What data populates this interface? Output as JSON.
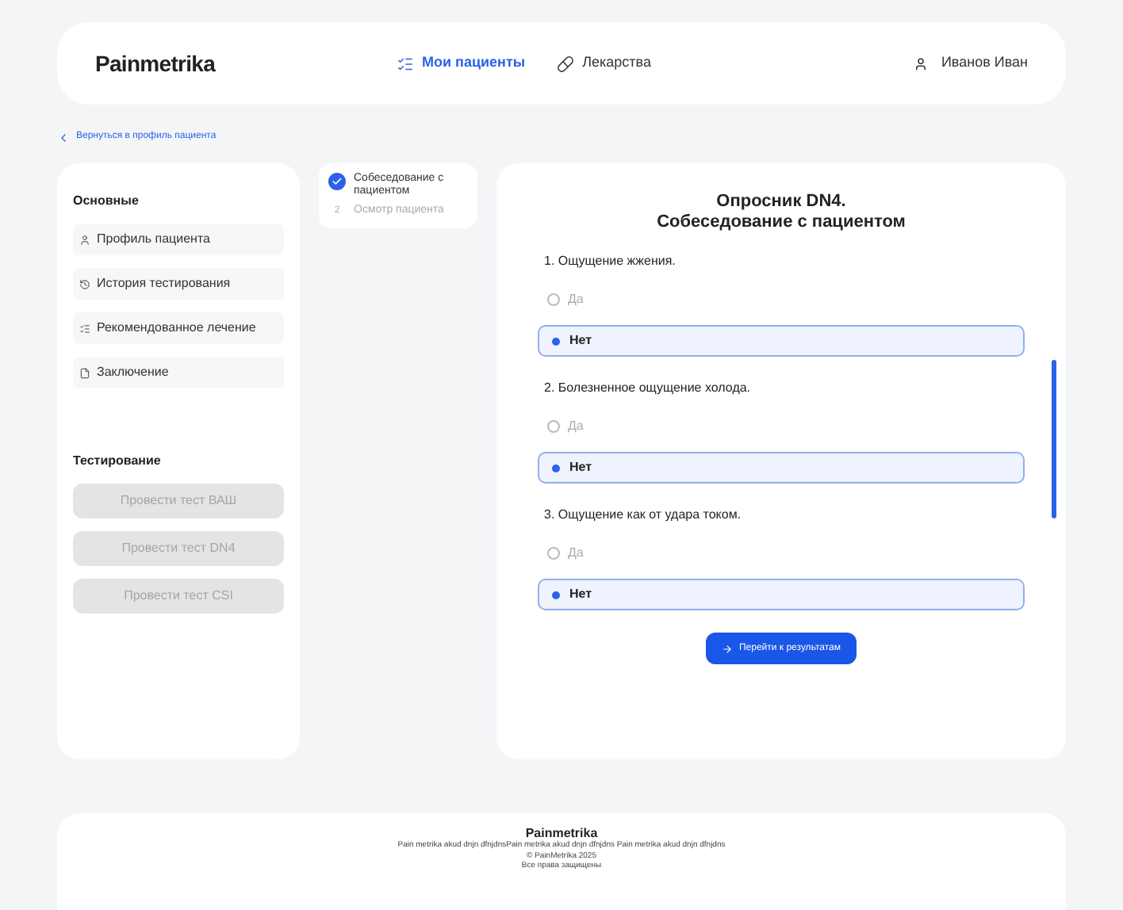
{
  "header": {
    "logo": "Painmetrika",
    "nav": [
      {
        "label": "Мои пациенты",
        "selected": true
      },
      {
        "label": "Лекарства",
        "selected": false
      }
    ],
    "user": "Иванов Иван"
  },
  "back_link": "Вернуться в профиль пациента",
  "sidebar": {
    "sections": [
      {
        "title": "Основные",
        "kind": "links",
        "items": [
          {
            "label": "Профиль пациента",
            "disabled": false
          },
          {
            "label": "История тестирования",
            "disabled": false
          },
          {
            "label": "Рекомендованное лечение",
            "disabled": false
          },
          {
            "label": "Заключение",
            "disabled": false
          }
        ]
      },
      {
        "title": "Тестирование",
        "kind": "buttons",
        "items": [
          {
            "label": "Провести тест ВАШ",
            "disabled": true
          },
          {
            "label": "Провести тест DN4",
            "disabled": true
          },
          {
            "label": "Провести тест CSI",
            "disabled": true
          }
        ]
      }
    ]
  },
  "steps": [
    {
      "label": "Собеседование с пациентом",
      "done": true
    },
    {
      "number": "2",
      "label": "Осмотр пациента",
      "done": false
    }
  ],
  "questionnaire": {
    "title": "Опросник DN4.",
    "subtitle": "Собеседование с пациентом",
    "questions": [
      {
        "text": "1. Ощущение жжения.",
        "options": [
          {
            "label": "Да",
            "selected": false
          },
          {
            "label": "Нет",
            "selected": true
          }
        ]
      },
      {
        "text": "2. Болезненное ощущение холода.",
        "options": [
          {
            "label": "Да",
            "selected": false
          },
          {
            "label": "Нет",
            "selected": true
          }
        ]
      },
      {
        "text": "3. Ощущение как от удара током.",
        "options": [
          {
            "label": "Да",
            "selected": false
          },
          {
            "label": "Нет",
            "selected": true
          }
        ]
      }
    ],
    "submit": "Перейти к результатам"
  },
  "footer": {
    "logo": "Painmetrika",
    "text": "Pain metrika akud dnjn dfnjdnsPain metrika akud dnjn dfnjdns Pain metrika akud dnjn dfnjdns",
    "copyright": "© PainMetrika 2025",
    "rights": "Все права защищены"
  }
}
